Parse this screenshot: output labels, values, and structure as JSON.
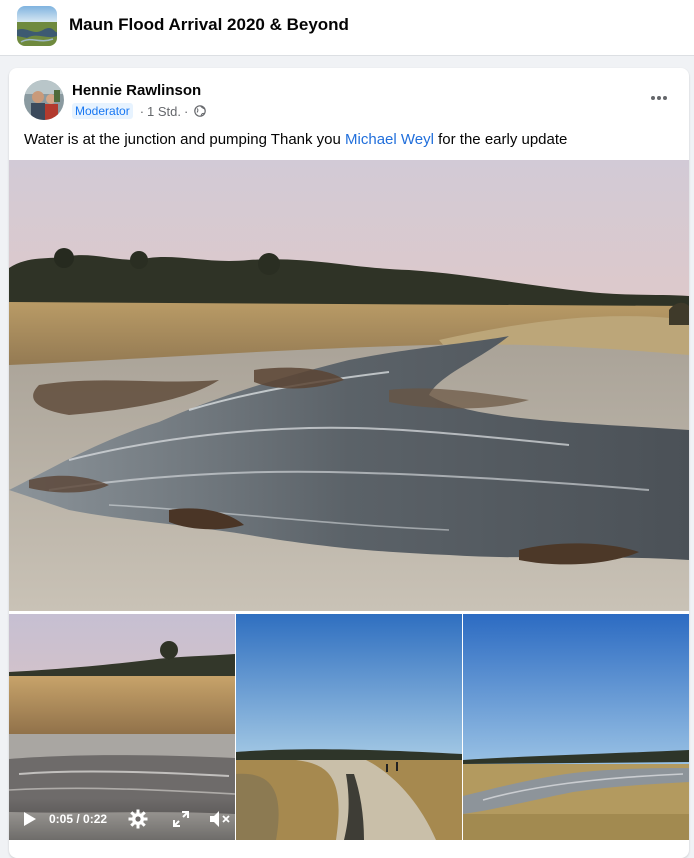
{
  "group": {
    "title": "Maun Flood Arrival 2020 & Beyond"
  },
  "post": {
    "author": "Hennie Rawlinson",
    "role_badge": "Moderator",
    "time": "1 Std.",
    "dot": "·",
    "text_before": "Water is at the junction and pumping Thank you ",
    "mention": "Michael Weyl",
    "text_after": " for the early update"
  },
  "video": {
    "time_display": "0:05 / 0:22"
  },
  "icons": {
    "more": "more-options-icon",
    "privacy": "globe-icon",
    "play": "play-icon",
    "settings": "gear-icon",
    "fullscreen": "fullscreen-icon",
    "mute": "muted-speaker-icon"
  },
  "colors": {
    "accent": "#1877f2",
    "mention": "#216fdb",
    "muted_text": "#65676b"
  }
}
